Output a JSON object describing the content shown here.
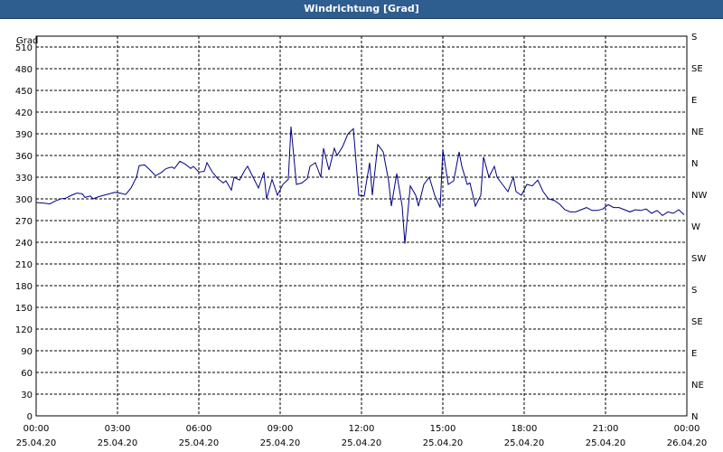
{
  "window": {
    "title": "Windrichtung [Grad]"
  },
  "chart_data": {
    "type": "line",
    "title": "Windrichtung [Grad]",
    "ylabel": "Grad",
    "ylim": [
      0,
      525
    ],
    "y_ticks": [
      0,
      30,
      60,
      90,
      120,
      150,
      180,
      210,
      240,
      270,
      300,
      330,
      360,
      390,
      420,
      450,
      480,
      510
    ],
    "right_ticks": [
      {
        "value": 0,
        "label": "N"
      },
      {
        "value": 45,
        "label": "NE"
      },
      {
        "value": 90,
        "label": "E"
      },
      {
        "value": 135,
        "label": "SE"
      },
      {
        "value": 180,
        "label": "S"
      },
      {
        "value": 225,
        "label": "SW"
      },
      {
        "value": 270,
        "label": "W"
      },
      {
        "value": 315,
        "label": "NW"
      },
      {
        "value": 360,
        "label": "N"
      },
      {
        "value": 405,
        "label": "NE"
      },
      {
        "value": 450,
        "label": "E"
      },
      {
        "value": 495,
        "label": "SE"
      },
      {
        "value": 540,
        "label": "S"
      }
    ],
    "xlim": [
      0,
      24
    ],
    "x_ticks": [
      {
        "value": 0,
        "time": "00:00",
        "date": "25.04.20"
      },
      {
        "value": 3,
        "time": "03:00",
        "date": "25.04.20"
      },
      {
        "value": 6,
        "time": "06:00",
        "date": "25.04.20"
      },
      {
        "value": 9,
        "time": "09:00",
        "date": "25.04.20"
      },
      {
        "value": 12,
        "time": "12:00",
        "date": "25.04.20"
      },
      {
        "value": 15,
        "time": "15:00",
        "date": "25.04.20"
      },
      {
        "value": 18,
        "time": "18:00",
        "date": "25.04.20"
      },
      {
        "value": 21,
        "time": "21:00",
        "date": "25.04.20"
      },
      {
        "value": 24,
        "time": "00:00",
        "date": "26.04.20"
      }
    ],
    "grid": true,
    "series": [
      {
        "color": "#000080",
        "points": [
          [
            0.0,
            295
          ],
          [
            0.3,
            294
          ],
          [
            0.5,
            293
          ],
          [
            0.7,
            297
          ],
          [
            0.9,
            300
          ],
          [
            1.1,
            301
          ],
          [
            1.3,
            305
          ],
          [
            1.5,
            308
          ],
          [
            1.7,
            307
          ],
          [
            1.8,
            302
          ],
          [
            2.0,
            304
          ],
          [
            2.1,
            300
          ],
          [
            2.3,
            303
          ],
          [
            2.5,
            305
          ],
          [
            2.7,
            307
          ],
          [
            2.9,
            309
          ],
          [
            3.1,
            308
          ],
          [
            3.3,
            306
          ],
          [
            3.5,
            315
          ],
          [
            3.7,
            330
          ],
          [
            3.8,
            346
          ],
          [
            4.0,
            347
          ],
          [
            4.2,
            340
          ],
          [
            4.4,
            332
          ],
          [
            4.6,
            336
          ],
          [
            4.8,
            342
          ],
          [
            5.0,
            344
          ],
          [
            5.1,
            342
          ],
          [
            5.3,
            352
          ],
          [
            5.5,
            348
          ],
          [
            5.7,
            342
          ],
          [
            5.8,
            345
          ],
          [
            6.0,
            337
          ],
          [
            6.2,
            338
          ],
          [
            6.3,
            350
          ],
          [
            6.5,
            337
          ],
          [
            6.7,
            328
          ],
          [
            6.9,
            322
          ],
          [
            7.0,
            325
          ],
          [
            7.2,
            312
          ],
          [
            7.3,
            330
          ],
          [
            7.5,
            326
          ],
          [
            7.7,
            340
          ],
          [
            7.8,
            345
          ],
          [
            8.0,
            330
          ],
          [
            8.2,
            315
          ],
          [
            8.4,
            337
          ],
          [
            8.5,
            300
          ],
          [
            8.7,
            327
          ],
          [
            8.9,
            305
          ],
          [
            9.1,
            320
          ],
          [
            9.3,
            327
          ],
          [
            9.4,
            400
          ],
          [
            9.6,
            320
          ],
          [
            9.8,
            322
          ],
          [
            10.0,
            328
          ],
          [
            10.1,
            345
          ],
          [
            10.3,
            350
          ],
          [
            10.5,
            330
          ],
          [
            10.6,
            370
          ],
          [
            10.8,
            340
          ],
          [
            11.0,
            370
          ],
          [
            11.1,
            360
          ],
          [
            11.3,
            372
          ],
          [
            11.5,
            390
          ],
          [
            11.7,
            397
          ],
          [
            11.9,
            305
          ],
          [
            12.1,
            304
          ],
          [
            12.3,
            350
          ],
          [
            12.4,
            305
          ],
          [
            12.6,
            375
          ],
          [
            12.8,
            365
          ],
          [
            13.0,
            325
          ],
          [
            13.1,
            290
          ],
          [
            13.3,
            335
          ],
          [
            13.5,
            290
          ],
          [
            13.6,
            238
          ],
          [
            13.8,
            318
          ],
          [
            14.0,
            305
          ],
          [
            14.1,
            290
          ],
          [
            14.3,
            320
          ],
          [
            14.5,
            330
          ],
          [
            14.7,
            305
          ],
          [
            14.9,
            288
          ],
          [
            15.0,
            368
          ],
          [
            15.2,
            320
          ],
          [
            15.4,
            325
          ],
          [
            15.6,
            365
          ],
          [
            15.7,
            345
          ],
          [
            15.9,
            320
          ],
          [
            16.0,
            322
          ],
          [
            16.2,
            290
          ],
          [
            16.4,
            305
          ],
          [
            16.5,
            358
          ],
          [
            16.7,
            330
          ],
          [
            16.9,
            345
          ],
          [
            17.0,
            330
          ],
          [
            17.2,
            320
          ],
          [
            17.4,
            310
          ],
          [
            17.6,
            330
          ],
          [
            17.7,
            310
          ],
          [
            17.9,
            305
          ],
          [
            18.1,
            320
          ],
          [
            18.3,
            318
          ],
          [
            18.5,
            326
          ],
          [
            18.7,
            310
          ],
          [
            18.9,
            300
          ],
          [
            19.1,
            298
          ],
          [
            19.3,
            293
          ],
          [
            19.5,
            285
          ],
          [
            19.7,
            282
          ],
          [
            19.9,
            282
          ],
          [
            20.1,
            285
          ],
          [
            20.3,
            288
          ],
          [
            20.5,
            284
          ],
          [
            20.7,
            284
          ],
          [
            20.9,
            286
          ],
          [
            21.1,
            292
          ],
          [
            21.3,
            288
          ],
          [
            21.5,
            288
          ],
          [
            21.7,
            285
          ],
          [
            21.9,
            282
          ],
          [
            22.1,
            285
          ],
          [
            22.3,
            284
          ],
          [
            22.5,
            286
          ],
          [
            22.7,
            280
          ],
          [
            22.9,
            284
          ],
          [
            23.1,
            277
          ],
          [
            23.3,
            282
          ],
          [
            23.5,
            280
          ],
          [
            23.7,
            285
          ],
          [
            23.9,
            278
          ]
        ]
      }
    ]
  }
}
